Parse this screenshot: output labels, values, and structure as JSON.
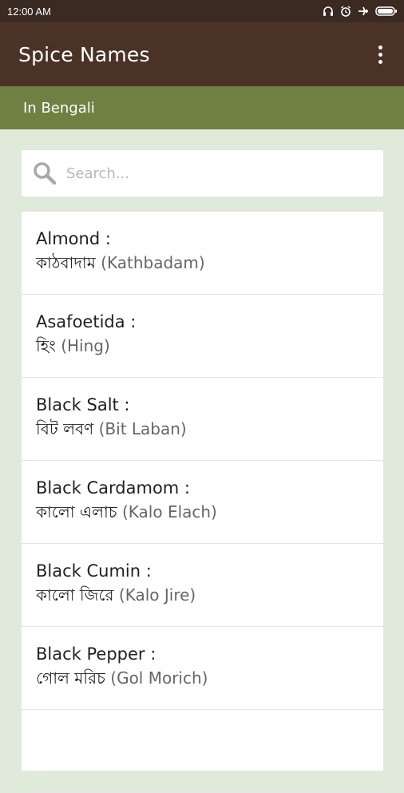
{
  "status_bar": {
    "time": "12:00 AM",
    "icons": [
      "headphones-icon",
      "alarm-icon",
      "airplane-icon",
      "battery-icon"
    ]
  },
  "app_bar": {
    "title": "Spice Names",
    "menu_icon": "more-vertical-icon"
  },
  "sub_bar": {
    "label": "In Bengali"
  },
  "search": {
    "placeholder": "Search...",
    "value": "",
    "icon": "search-icon"
  },
  "spices": [
    {
      "name": "Almond :",
      "bengali": "কাঠবাদাম",
      "translit": " (Kathbadam)"
    },
    {
      "name": "Asafoetida :",
      "bengali": "হিং",
      "translit": " (Hing)"
    },
    {
      "name": "Black Salt :",
      "bengali": "বিট লবণ",
      "translit": " (Bit Laban)"
    },
    {
      "name": "Black Cardamom :",
      "bengali": "কালো এলাচ",
      "translit": " (Kalo Elach)"
    },
    {
      "name": "Black Cumin :",
      "bengali": "কালো জিরে",
      "translit": " (Kalo Jire)"
    },
    {
      "name": "Black Pepper :",
      "bengali": "গোল মরিচ",
      "translit": " (Gol Morich)"
    }
  ]
}
